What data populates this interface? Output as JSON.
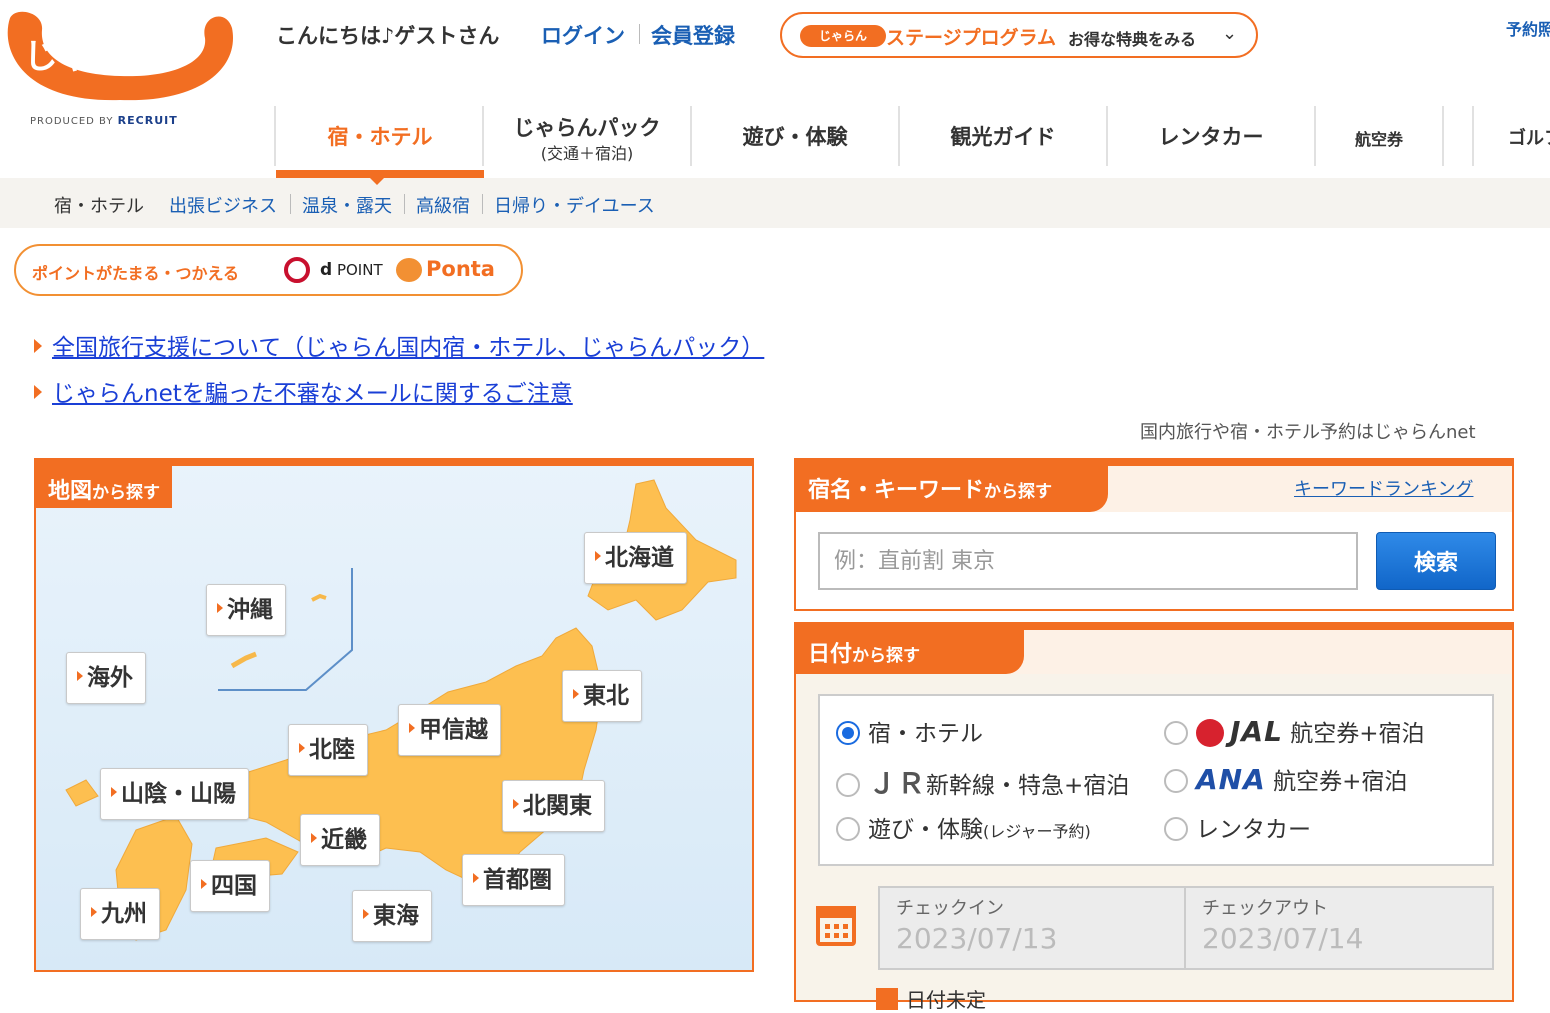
{
  "colors": {
    "brand_orange": "#f26e22",
    "link_blue": "#1a5fb4",
    "search_blue": "#1166c9"
  },
  "header": {
    "logo_text": "じゃらん",
    "produced_by": "PRODUCED BY",
    "recruit": "RECRUIT",
    "greeting": "こんにちは♪ゲストさん",
    "login": "ログイン",
    "register": "会員登録",
    "stage_pill": "じゃらん",
    "stage_title": "ステージプログラム",
    "stage_sub": "お得な特典をみる",
    "yoyaku": "予約照"
  },
  "gnav": [
    {
      "label": "宿・ホテル",
      "sub": "",
      "active": true
    },
    {
      "label": "じゃらんパック",
      "sub": "(交通＋宿泊)"
    },
    {
      "label": "遊び・体験",
      "sub": ""
    },
    {
      "label": "観光ガイド",
      "sub": ""
    },
    {
      "label": "レンタカー",
      "sub": ""
    },
    {
      "label": "航空券",
      "sub": ""
    },
    {
      "label": "ゴルフ",
      "sub": ""
    }
  ],
  "subnav": {
    "current": "宿・ホテル",
    "links": [
      "出張ビジネス",
      "温泉・露天",
      "高級宿",
      "日帰り・デイユース"
    ]
  },
  "point_banner": {
    "text": "ポイントがたまる・つかえる",
    "dpoint": "POINT",
    "ponta": "Ponta"
  },
  "notices": [
    "全国旅行支援について（じゃらん国内宿・ホテル、じゃらんパック）",
    "じゃらんnetを騙った不審なメールに関するご注意"
  ],
  "tagline": "国内旅行や宿・ホテル予約はじゃらんnet",
  "map": {
    "title": "地図",
    "title_suffix": "から探す",
    "regions": [
      "北海道",
      "沖縄",
      "海外",
      "東北",
      "甲信越",
      "北陸",
      "山陰・山陽",
      "北関東",
      "近畿",
      "首都圏",
      "四国",
      "九州",
      "東海"
    ]
  },
  "keyword": {
    "title": "宿名・キーワード",
    "title_suffix": "から探す",
    "ranking": "キーワードランキング",
    "placeholder": "例：直前割 東京",
    "button": "検索"
  },
  "date_search": {
    "title": "日付",
    "title_suffix": "から探す",
    "options": {
      "hotel": "宿・ホテル",
      "jal_brand": "JAL",
      "jal": "航空券+宿泊",
      "jr_brand": "ＪＲ",
      "jr": "新幹線・特急+宿泊",
      "ana_brand": "ANA",
      "ana": "航空券+宿泊",
      "leisure": "遊び・体験",
      "leisure_note": "(レジャー予約)",
      "rentacar": "レンタカー"
    },
    "selected": "hotel",
    "checkin_label": "チェックイン",
    "checkin_value": "2023/07/13",
    "checkout_label": "チェックアウト",
    "checkout_value": "2023/07/14",
    "undecided": "日付未定"
  }
}
